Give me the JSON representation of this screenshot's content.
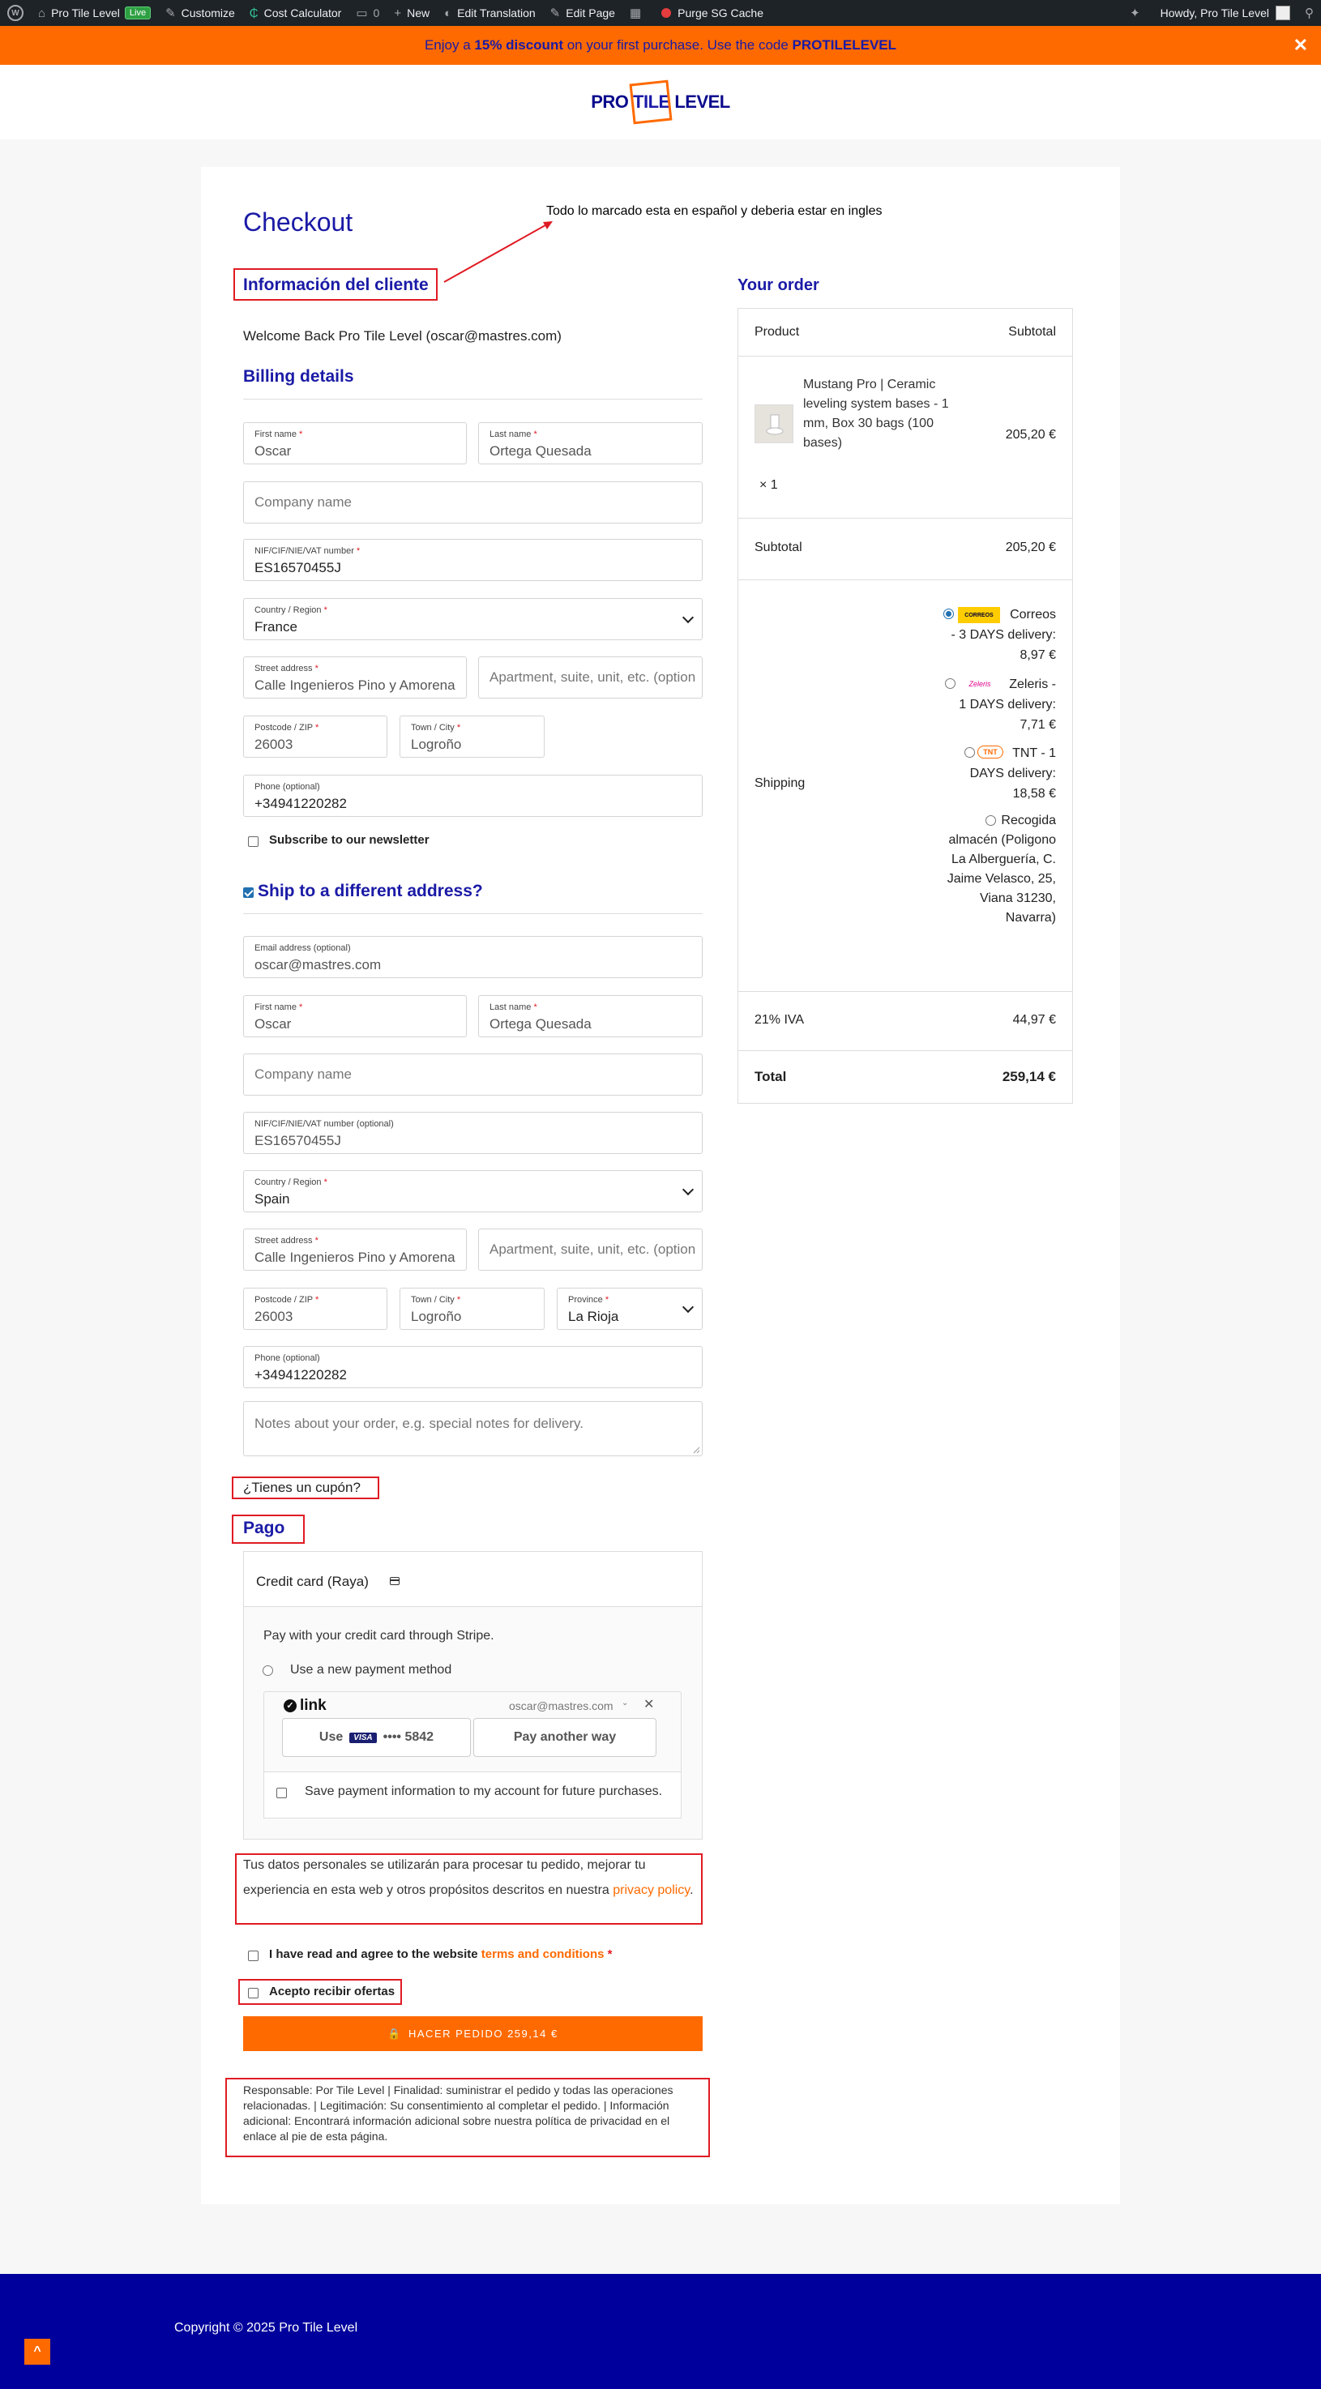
{
  "admin_bar": {
    "site_name": "Pro Tile Level",
    "live_badge": "Live",
    "customize": "Customize",
    "cost_calculator": "Cost Calculator",
    "comments_count": "0",
    "new": "New",
    "edit_translation": "Edit Translation",
    "edit_page": "Edit Page",
    "purge_cache": "Purge SG Cache",
    "howdy": "Howdy, Pro Tile Level"
  },
  "promo": {
    "prefix": "Enjoy a ",
    "discount": "15% discount",
    "middle": " on your first purchase. Use the code ",
    "code": "PROTILELEVEL",
    "close": "✕"
  },
  "logo": {
    "pro": "PRO",
    "tile": "TILE",
    "level": "LEVEL"
  },
  "checkout": {
    "title": "Checkout",
    "annotation": "Todo lo marcado esta en español y deberia estar en ingles",
    "customer_info": "Información del cliente",
    "welcome": "Welcome Back Pro Tile Level (oscar@mastres.com)",
    "billing_title": "Billing details",
    "billing": {
      "first_name_label": "First name",
      "first_name": "Oscar",
      "last_name_label": "Last name",
      "last_name": "Ortega Quesada",
      "company_placeholder": "Company name",
      "vat_label": "NIF/CIF/NIE/VAT number",
      "vat": "ES16570455J",
      "country_label": "Country / Region",
      "country": "France",
      "street_label": "Street address",
      "street": "Calle Ingenieros Pino y Amorena",
      "apartment_placeholder": "Apartment, suite, unit, etc. (optional)",
      "postcode_label": "Postcode / ZIP",
      "postcode": "26003",
      "city_label": "Town / City",
      "city": "Logroño",
      "phone_label": "Phone (optional)",
      "phone": "+34941220282"
    },
    "newsletter": "Subscribe to our newsletter",
    "ship_different": "Ship to a different address?",
    "shipping": {
      "email_label": "Email address (optional)",
      "email": "oscar@mastres.com",
      "first_name_label": "First name",
      "first_name": "Oscar",
      "last_name_label": "Last name",
      "last_name": "Ortega Quesada",
      "company_placeholder": "Company name",
      "vat_label": "NIF/CIF/NIE/VAT number (optional)",
      "vat": "ES16570455J",
      "country_label": "Country / Region",
      "country": "Spain",
      "street_label": "Street address",
      "street": "Calle Ingenieros Pino y Amorena",
      "apartment_placeholder": "Apartment, suite, unit, etc. (optional)",
      "postcode_label": "Postcode / ZIP",
      "postcode": "26003",
      "city_label": "Town / City",
      "city": "Logroño",
      "province_label": "Province",
      "province": "La Rioja",
      "phone_label": "Phone (optional)",
      "phone": "+34941220282",
      "notes_placeholder": "Notes about your order, e.g. special notes for delivery."
    },
    "coupon": "¿Tienes un cupón?",
    "payment_title": "Pago",
    "payment": {
      "method": "Credit card (Raya)",
      "description": "Pay with your credit card through Stripe.",
      "use_new": "Use a new payment method",
      "link_brand": "link",
      "link_email": "oscar@mastres.com",
      "use_prefix": "Use",
      "card_brand": "VISA",
      "card_last4": "•••• 5842",
      "pay_another": "Pay another way",
      "save_info": "Save payment information to my account for future purchases."
    },
    "privacy_text": "Tus datos personales se utilizarán para procesar tu pedido, mejorar tu experiencia en esta web y otros propósitos descritos en nuestra",
    "privacy_link": "privacy policy",
    "terms_prefix": "I have read and agree to the website",
    "terms_link": "terms and conditions",
    "offers": "Acepto recibir ofertas",
    "place_order": "HACER PEDIDO 259,14 €",
    "legal": "Responsable: Por Tile Level | Finalidad: suministrar el pedido y todas las operaciones relacionadas. | Legitimación: Su consentimiento al completar el pedido. | Información adicional: Encontrará información adicional sobre nuestra política de privacidad en el enlace al pie de esta página."
  },
  "order": {
    "title": "Your order",
    "col_product": "Product",
    "col_subtotal": "Subtotal",
    "product_name": "Mustang Pro | Ceramic leveling system bases - 1 mm, Box 30 bags (100 bases)",
    "product_qty": "× 1",
    "product_price": "205,20 €",
    "subtotal_label": "Subtotal",
    "subtotal": "205,20 €",
    "shipping_label": "Shipping",
    "shipping_options": [
      {
        "logo": "CORREOS",
        "text": "Correos - 3 DAYS delivery: 8,97 €"
      },
      {
        "logo": "Zeleris",
        "text": "Zeleris - 1 DAYS delivery: 7,71 €"
      },
      {
        "logo": "TNT",
        "text": "TNT - 1 DAYS delivery: 18,58 €"
      },
      {
        "logo": "",
        "text": "Recogida almacén (Poligono La Alberguería, C. Jaime Velasco, 25, Viana 31230, Navarra)"
      }
    ],
    "tax_label": "21% IVA",
    "tax": "44,97 €",
    "total_label": "Total",
    "total": "259,14 €"
  },
  "footer": {
    "copyright": "Copyright © 2025 Pro Tile Level",
    "top_icon": "^"
  }
}
